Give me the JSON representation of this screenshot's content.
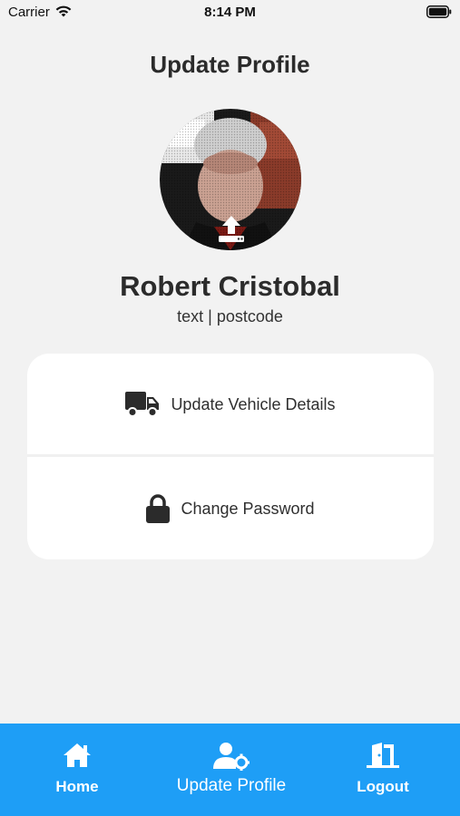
{
  "status_bar": {
    "carrier": "Carrier",
    "time": "8:14 PM"
  },
  "page": {
    "title": "Update Profile"
  },
  "profile": {
    "name": "Robert Cristobal",
    "subtitle": "text | postcode",
    "avatar_overlay_icon": "upload-icon"
  },
  "menu": [
    {
      "label": "Update Vehicle Details",
      "icon": "truck-icon"
    },
    {
      "label": "Change Password",
      "icon": "lock-icon"
    }
  ],
  "tabbar": {
    "home": "Home",
    "profile": "Update Profile",
    "logout": "Logout",
    "accent": "#1e9ef6"
  }
}
